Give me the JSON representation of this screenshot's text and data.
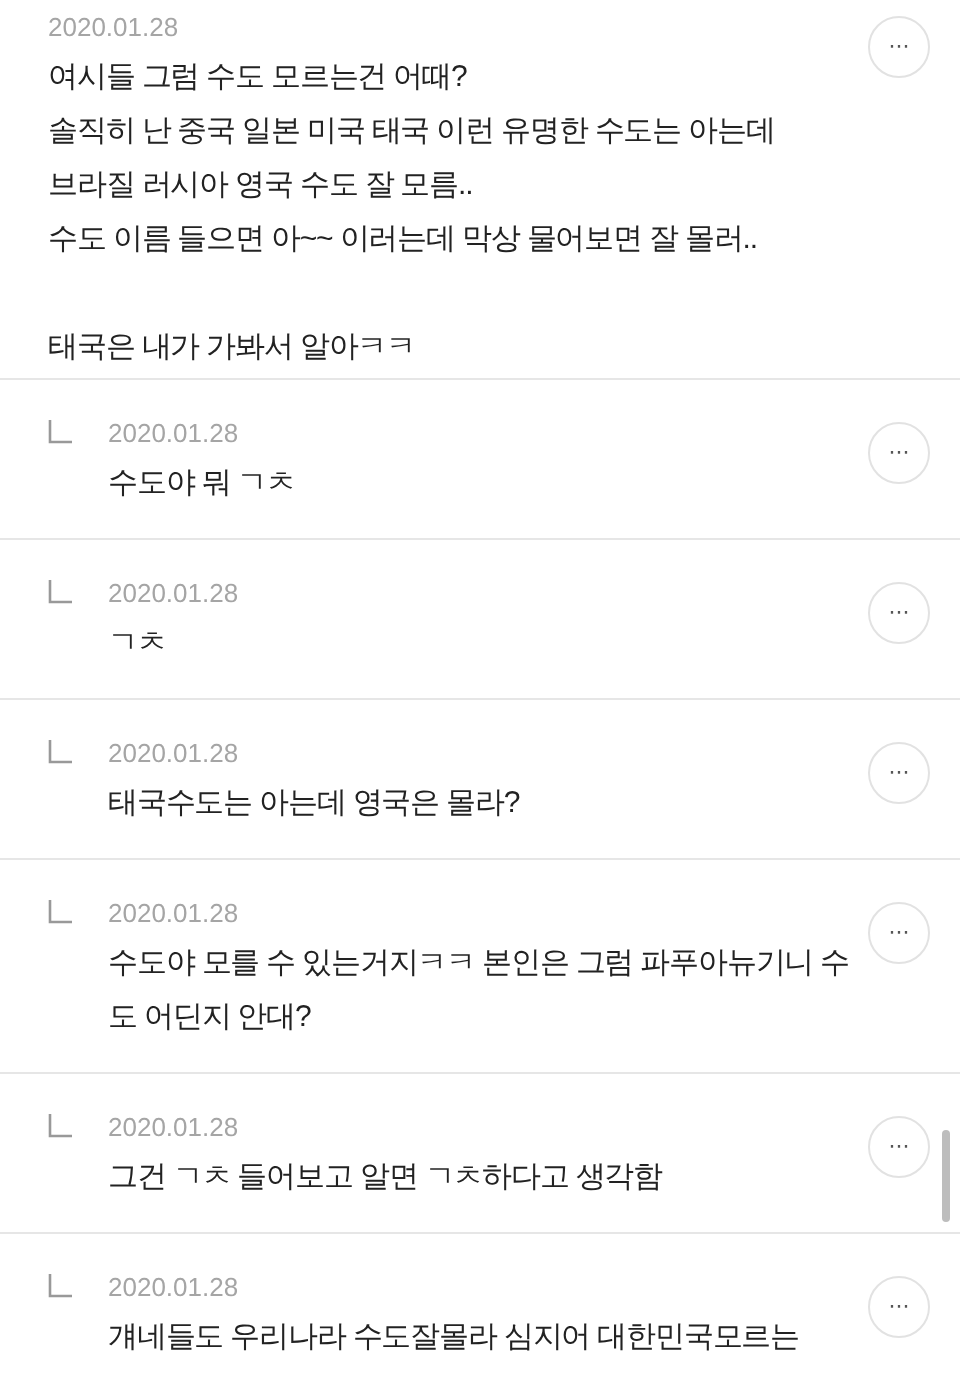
{
  "comment": {
    "date": "2020.01.28",
    "text": "여시들 그럼 수도 모르는건 어때?\n솔직히 난 중국 일본 미국 태국 이런 유명한 수도는 아는데\n브라질 러시아 영국 수도 잘 모름..\n수도 이름 들으면 아~~ 이러는데 막상 물어보면 잘 몰러..\n\n태국은 내가 가봐서 알아ㅋㅋ",
    "more": "···"
  },
  "replies": [
    {
      "date": "2020.01.28",
      "text": "수도야 뭐 ㄱㅊ",
      "more": "···"
    },
    {
      "date": "2020.01.28",
      "text": "ㄱㅊ",
      "more": "···"
    },
    {
      "date": "2020.01.28",
      "text": "태국수도는 아는데 영국은 몰라?",
      "more": "···"
    },
    {
      "date": "2020.01.28",
      "text": "수도야 모를 수 있는거지ㅋㅋ 본인은 그럼 파푸아뉴기니 수도 어딘지 안대?",
      "more": "···"
    },
    {
      "date": "2020.01.28",
      "text": "그건 ㄱㅊ 들어보고 알면 ㄱㅊ하다고 생각함",
      "more": "···"
    },
    {
      "date": "2020.01.28",
      "text": "걔네들도 우리나라 수도잘몰라 심지어 대한민국모르는",
      "more": "···"
    }
  ]
}
